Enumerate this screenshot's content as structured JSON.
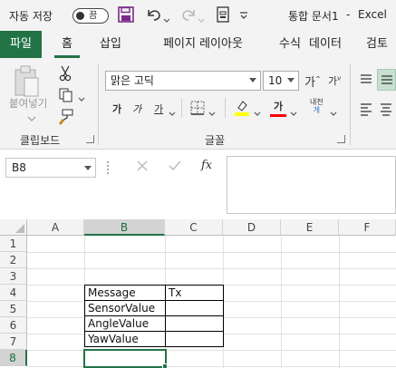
{
  "titlebar": {
    "autosave_label": "자동 저장",
    "autosave_state": "끔",
    "document_title": "통합 문서1",
    "separator": "-",
    "app_name": "Excel"
  },
  "tabs": [
    "파일",
    "홈",
    "삽입",
    "페이지 레이아웃",
    "수식",
    "데이터",
    "검토"
  ],
  "ribbon": {
    "clipboard": {
      "paste_label": "붙여넣기",
      "group_label": "클립보드"
    },
    "font": {
      "font_name": "맑은 고딕",
      "font_size": "10",
      "grow_label": "가",
      "shrink_label": "가",
      "bold_label": "가",
      "italic_label": "가",
      "underline_label": "가",
      "font_color_label": "가",
      "phonetic_label_top": "내천",
      "phonetic_label_bottom": "개",
      "group_label": "글꼴"
    },
    "colors": {
      "highlight": "#ffff00",
      "font_color": "#ff0000",
      "accent": "#217346"
    }
  },
  "formula_bar": {
    "name_box": "B8",
    "fx_label": "fx",
    "formula_value": ""
  },
  "sheet": {
    "columns": [
      "A",
      "B",
      "C",
      "D",
      "E",
      "F"
    ],
    "rows": [
      "1",
      "2",
      "3",
      "4",
      "5",
      "6",
      "7",
      "8"
    ],
    "selected_cell": "B8",
    "cells": {
      "B4": "Message",
      "C4": "Tx",
      "B5": "SensorValue",
      "B6": "AngleValue",
      "B7": "YawValue"
    }
  }
}
